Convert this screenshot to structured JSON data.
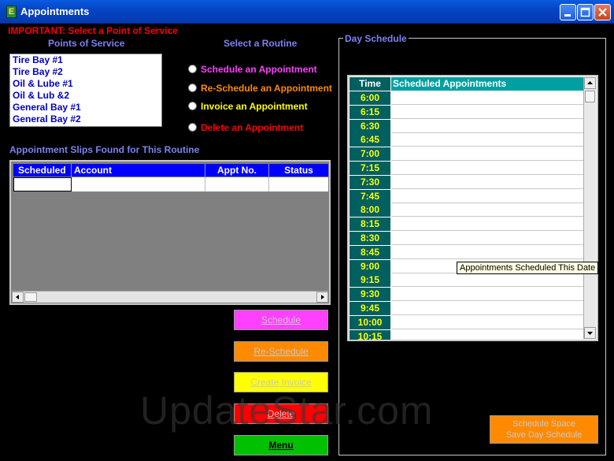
{
  "window": {
    "title": "Appointments"
  },
  "colors": {
    "important": "#ff0000",
    "section_label": "#7d82f0",
    "listbox_text": "#0000c0",
    "time_text": "#ffff00"
  },
  "important_note": "IMPORTANT: Select a Point of Service",
  "points_of_service": {
    "label": "Points of Service",
    "items": [
      "Tire Bay #1",
      "Tire Bay #2",
      "Oil & Lube #1",
      "Oil & Lub &2",
      "General Bay #1",
      "General Bay #2"
    ]
  },
  "routine": {
    "label": "Select a Routine",
    "options": [
      {
        "label": "Schedule an Appointment",
        "color": "#ff40ff"
      },
      {
        "label": "Re-Schedule an Appointment",
        "color": "#ff8a00"
      },
      {
        "label": "Invoice an Appointment",
        "color": "#ffff00"
      },
      {
        "label": "Delete an Appointment",
        "color": "#ff0000"
      }
    ]
  },
  "slips": {
    "label": "Appointment Slips Found for This Routine",
    "columns": [
      "Scheduled",
      "Account",
      "Appt No.",
      "Status"
    ]
  },
  "buttons": [
    {
      "label": "Schedule",
      "color": "#ff40ff"
    },
    {
      "label": "Re-Schedule",
      "color": "#ff8a00"
    },
    {
      "label": "Create Invoice",
      "color": "#ffff00"
    },
    {
      "label": "Delete",
      "color": "#ff0000"
    },
    {
      "label": "Menu",
      "color": "#00c000"
    }
  ],
  "day_schedule": {
    "label": "Day Schedule",
    "time_header": "Time",
    "appointments_header": "Scheduled Appointments",
    "times": [
      "6:00",
      "6:15",
      "6:30",
      "6:45",
      "7:00",
      "7:15",
      "7:30",
      "7:45",
      "8:00",
      "8:15",
      "8:30",
      "8:45",
      "9:00",
      "9:15",
      "9:30",
      "9:45",
      "10:00",
      "10:15"
    ],
    "tooltip": "Appointments Scheduled This Date"
  },
  "schedule_space": {
    "line1": "Schedule Space",
    "line2": "Save Day Schedule"
  },
  "watermark": "UpdateStar.com"
}
